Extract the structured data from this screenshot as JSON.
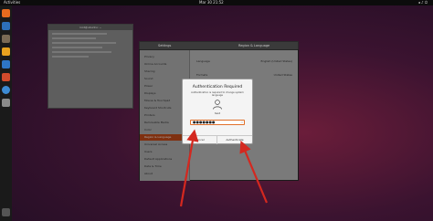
{
  "topbar": {
    "activities": "Activities",
    "clock": "Mar 30 21:52",
    "tray": "◂ ♪ ⏻"
  },
  "dock": {
    "icons": [
      "firefox-icon",
      "mail-icon",
      "files-icon",
      "music-icon",
      "writer-icon",
      "software-icon",
      "help-icon",
      "settings-icon",
      "apps-grid-icon"
    ]
  },
  "background_window": {
    "title": "root@ubuntu: ~"
  },
  "settings": {
    "header_left": "Settings",
    "header_right": "Region & Language",
    "sidebar": [
      "Privacy",
      "Online Accounts",
      "Sharing",
      "Sound",
      "Power",
      "Displays",
      "Mouse & Touchpad",
      "Keyboard Shortcuts",
      "Printers",
      "Removable Media",
      "Color",
      "Region & Language",
      "Universal Access",
      "Users",
      "Default Applications",
      "Date & Time",
      "About"
    ],
    "active_index": 11,
    "rows": [
      {
        "label": "Language",
        "value": "English (United States)"
      },
      {
        "label": "Formats",
        "value": "United States"
      },
      {
        "label": "Input Sources",
        "value": ""
      },
      {
        "label": "English (US)",
        "value": ""
      },
      {
        "label": "Manage Installed Languages",
        "value": ""
      }
    ]
  },
  "dialog": {
    "title": "Authentication Required",
    "message": "Authentication is required to change system language",
    "username": "test",
    "password": "●●●●●●●",
    "cancel": "Cancel",
    "authenticate": "Authenticate"
  },
  "colors": {
    "accent": "#e0702a",
    "active_item": "#c44a1a",
    "arrow": "#d4281f"
  }
}
